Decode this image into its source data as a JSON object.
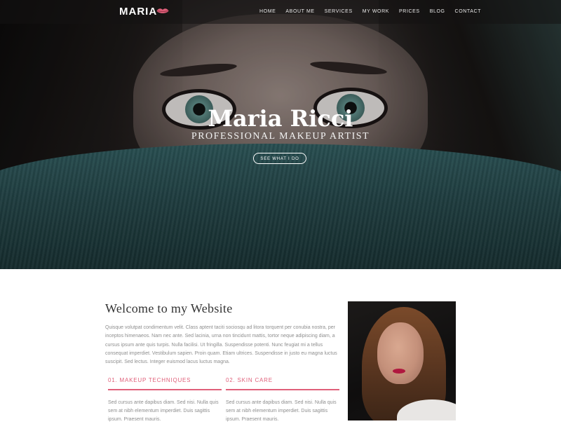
{
  "nav": {
    "logo": "MARIA",
    "items": [
      "HOME",
      "ABOUT ME",
      "SERVICES",
      "MY WORK",
      "PRICES",
      "BLOG",
      "CONTACT"
    ]
  },
  "hero": {
    "title": "Maria Ricci",
    "subtitle": "PROFESSIONAL MAKEUP ARTIST",
    "button": "SEE WHAT I DO"
  },
  "welcome": {
    "title": "Welcome to my Website",
    "text": "Quisque volutpat condimentum velit. Class aptent taciti sociosqu ad litora torquent per conubia nostra, per inceptos himenaeos. Nam nec ante. Sed lacinia, urna non tincidunt mattis, tortor neque adipiscing diam, a cursus ipsum ante quis turpis. Nulla facilisi. Ut fringilla. Suspendisse potenti. Nunc feugiat mi a tellus consequat imperdiet. Vestibulum sapien. Proin quam. Etiam ultrices. Suspendisse in justo eu magna luctus suscipit. Sed lectus. Integer euismod lacus luctus magna."
  },
  "columns": [
    {
      "title": "01. MAKEUP TECHNIQUES",
      "text": "Sed cursus ante dapibus diam. Sed nisi. Nulla quis sem at nibh elementum imperdiet. Duis sagittis ipsum. Praesent mauris."
    },
    {
      "title": "02. SKIN CARE",
      "text": "Sed cursus ante dapibus diam. Sed nisi. Nulla quis sem at nibh elementum imperdiet. Duis sagittis ipsum. Praesent mauris."
    }
  ],
  "colors": {
    "accent": "#e0607a",
    "nav_bg": "#141212",
    "text_muted": "#8e8e8e",
    "heading": "#333333"
  },
  "icons": {
    "logo_icon": "lips-icon"
  }
}
